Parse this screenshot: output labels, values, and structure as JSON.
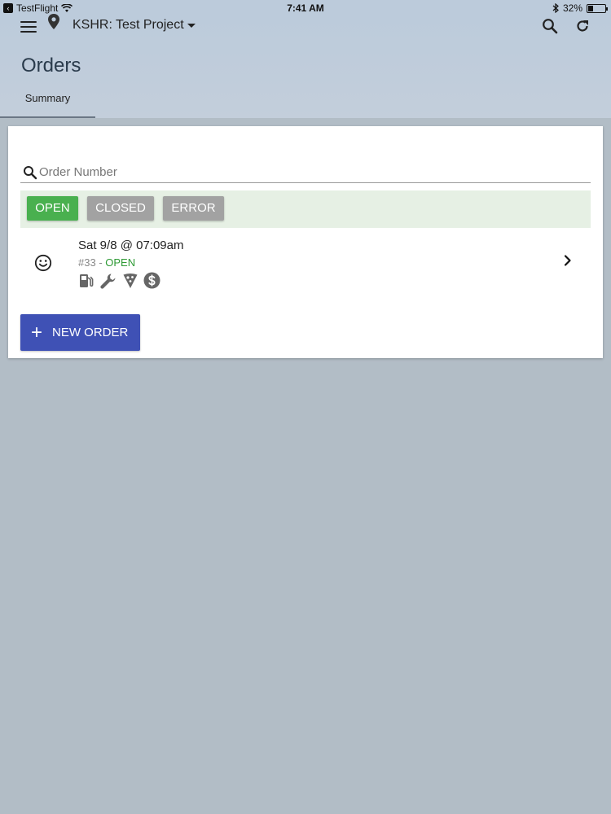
{
  "status_bar": {
    "app_name": "TestFlight",
    "time": "7:41 AM",
    "battery_percent": "32%",
    "battery_level": 0.32
  },
  "header": {
    "project": "KSHR: Test Project",
    "title": "Orders",
    "tabs": [
      {
        "label": "Summary",
        "active": true
      }
    ]
  },
  "search": {
    "placeholder": "Order Number",
    "value": ""
  },
  "filters": [
    {
      "label": "OPEN",
      "active": true
    },
    {
      "label": "CLOSED",
      "active": false
    },
    {
      "label": "ERROR",
      "active": false
    }
  ],
  "orders": [
    {
      "date": "Sat 9/8 @ 07:09am",
      "number": "#33",
      "separator": " - ",
      "status": "OPEN",
      "icons": [
        "fuel-icon",
        "wrench-icon",
        "pizza-icon",
        "dollar-icon"
      ]
    }
  ],
  "actions": {
    "new_order_label": "NEW ORDER"
  },
  "colors": {
    "open": "#49b04f",
    "inactive_filter": "#a2a2a2",
    "primary": "#3f51b5",
    "header_bg": "#bccbdb",
    "page_bg": "#b2bdc6"
  }
}
